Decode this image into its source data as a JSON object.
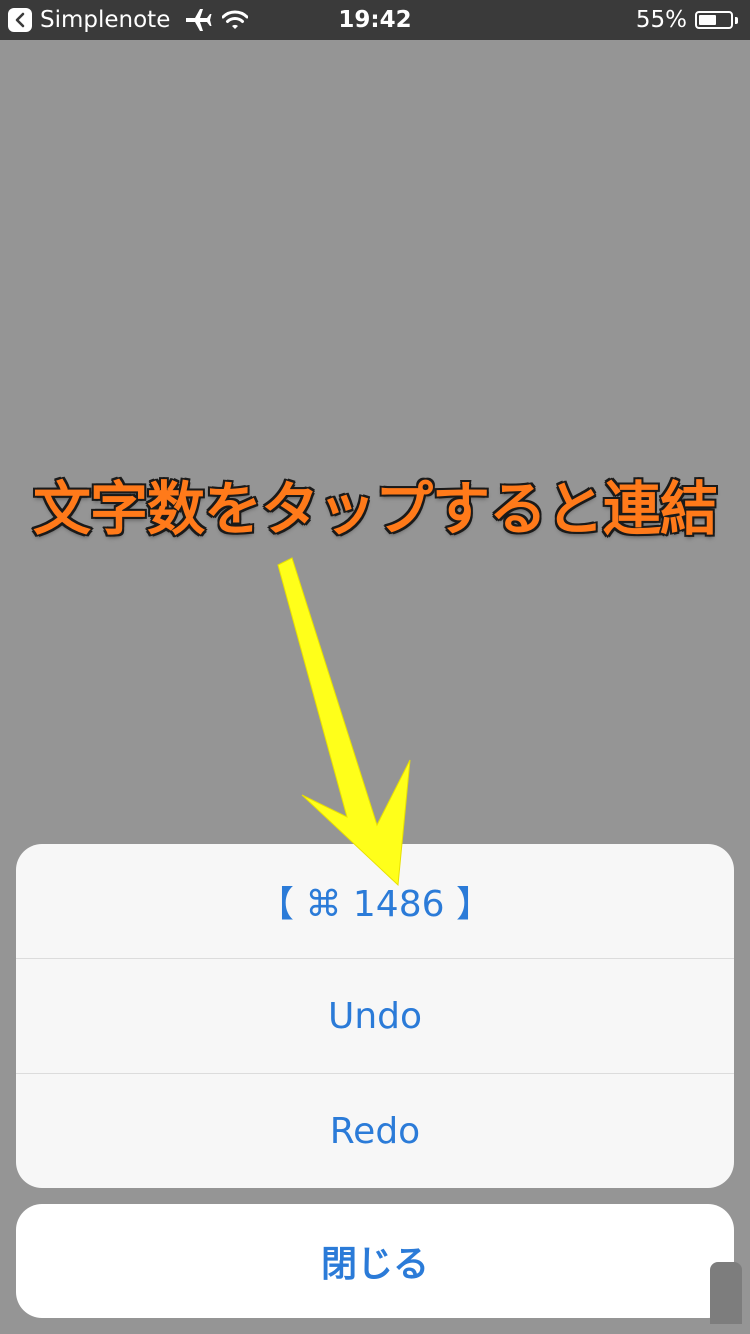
{
  "status_bar": {
    "app_name": "Simplenote",
    "time": "19:42",
    "battery_percent_label": "55%",
    "battery_level": 0.55,
    "back_icon": "chevron-left-icon",
    "airplane_icon": "airplane-icon",
    "wifi_icon": "wifi-icon",
    "battery_icon": "battery-icon"
  },
  "annotation": {
    "text": "文字数をタップすると連結",
    "color": "#ff7a1a",
    "arrow_color": "#ffff1a"
  },
  "action_sheet": {
    "items": [
      {
        "label": "【 ⌘ 1486 】"
      },
      {
        "label": "Undo"
      },
      {
        "label": "Redo"
      }
    ],
    "cancel_label": "閉じる",
    "tint_color": "#2b7bd8"
  }
}
